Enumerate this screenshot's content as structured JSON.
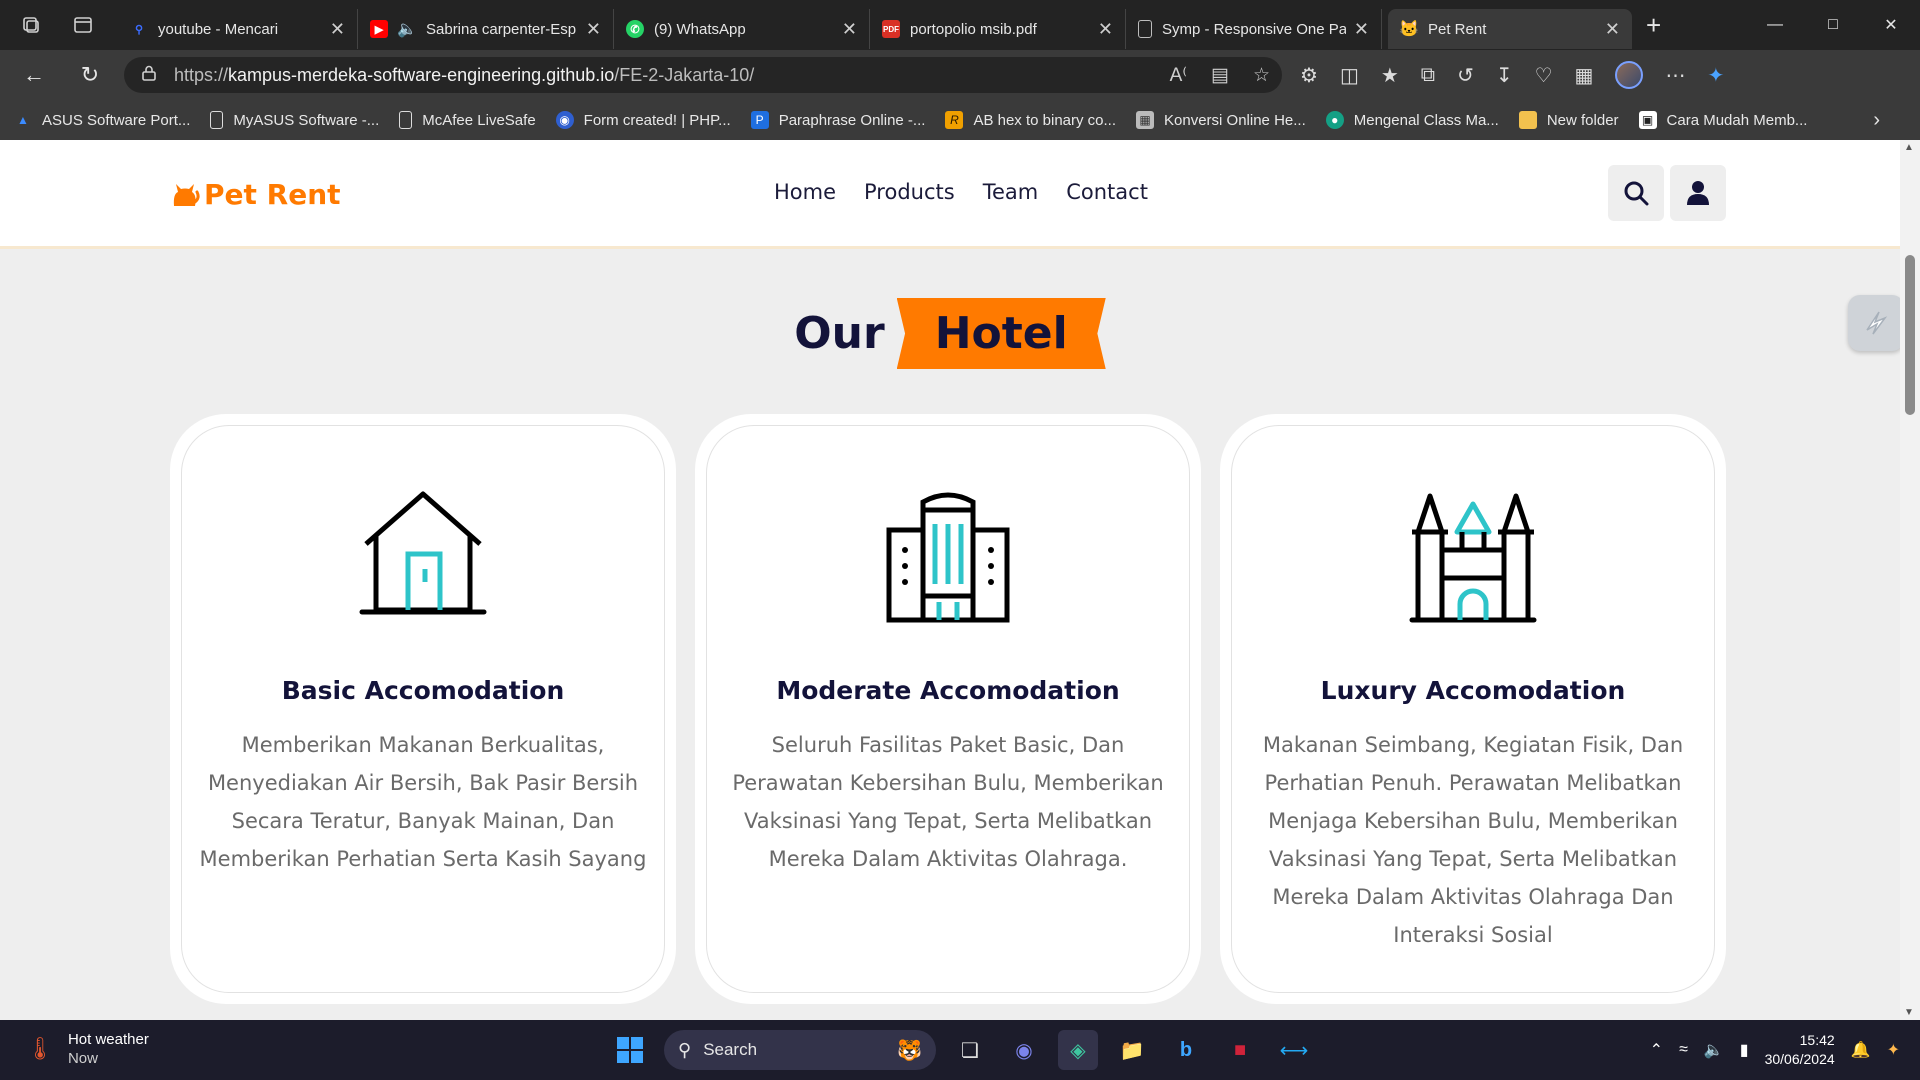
{
  "browser": {
    "tabs": [
      {
        "title": "youtube - Mencari",
        "icon": "search-icon",
        "color": "#3b6cff"
      },
      {
        "title": "Sabrina carpenter-Esp",
        "icon": "youtube-icon",
        "color": "#ff0000"
      },
      {
        "title": "(9) WhatsApp",
        "icon": "whatsapp-icon",
        "color": "#25d366"
      },
      {
        "title": "portopolio msib.pdf",
        "icon": "pdf-icon",
        "color": "#d93025"
      },
      {
        "title": "Symp - Responsive One Pa",
        "icon": "page-icon",
        "color": "#bdbdbd"
      },
      {
        "title": "Pet Rent",
        "icon": "cat-icon",
        "color": "#ff7a00"
      }
    ],
    "url_prefix": "https://",
    "url_host": "kampus-merdeka-software-engineering.github.io",
    "url_path": "/FE-2-Jakarta-10/",
    "bookmarks": [
      {
        "label": "ASUS Software Port...",
        "icon": "asus-icon"
      },
      {
        "label": "MyASUS Software -...",
        "icon": "page-icon"
      },
      {
        "label": "McAfee LiveSafe",
        "icon": "page-icon"
      },
      {
        "label": "Form created! | PHP...",
        "icon": "form-icon"
      },
      {
        "label": "Paraphrase Online -...",
        "icon": "paraphrase-icon"
      },
      {
        "label": "AB hex to binary co...",
        "icon": "r-icon"
      },
      {
        "label": "Konversi Online He...",
        "icon": "calculator-icon"
      },
      {
        "label": "Mengenal Class Ma...",
        "icon": "class-icon"
      },
      {
        "label": "New folder",
        "icon": "folder-icon"
      },
      {
        "label": "Cara Mudah Memb...",
        "icon": "image-icon"
      }
    ]
  },
  "site": {
    "logo": "Pet Rent",
    "nav": [
      "Home",
      "Products",
      "Team",
      "Contact"
    ],
    "section_title_a": "Our",
    "section_title_b": "Hotel",
    "cards": [
      {
        "title": "Basic Accomodation",
        "text": "Memberikan Makanan Berkualitas, Menyediakan Air Bersih, Bak Pasir Bersih Secara Teratur, Banyak Mainan, Dan Memberikan Perhatian Serta Kasih Sayang",
        "icon": "house-icon"
      },
      {
        "title": "Moderate Accomodation",
        "text": "Seluruh Fasilitas Paket Basic, Dan Perawatan Kebersihan Bulu, Memberikan Vaksinasi Yang Tepat, Serta Melibatkan Mereka Dalam Aktivitas Olahraga.",
        "icon": "building-icon"
      },
      {
        "title": "Luxury Accomodation",
        "text": "Makanan Seimbang, Kegiatan Fisik, Dan Perhatian Penuh. Perawatan Melibatkan Menjaga Kebersihan Bulu, Memberikan Vaksinasi Yang Tepat, Serta Melibatkan Mereka Dalam Aktivitas Olahraga Dan Interaksi Sosial",
        "icon": "castle-icon"
      }
    ],
    "colors": {
      "accent": "#ff7a00",
      "heading": "#13133a",
      "teal": "#2ec4c9"
    }
  },
  "taskbar": {
    "weather_title": "Hot weather",
    "weather_sub": "Now",
    "search_label": "Search",
    "time": "15:42",
    "date": "30/06/2024"
  }
}
